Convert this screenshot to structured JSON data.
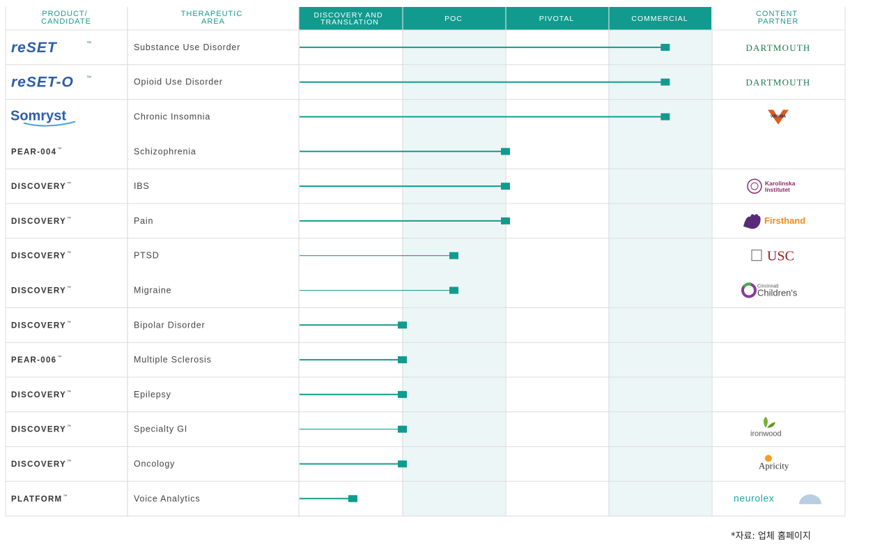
{
  "colors": {
    "accent": "#119b8f",
    "header_band": "#119b8f",
    "shade": "#ecf6f6",
    "grid": "#dcdcdc",
    "text": "#333333",
    "logo_blue": "#2b5da8",
    "dartmouth_green": "#1b7a50",
    "usc_red": "#9d1c20",
    "firsthand_orange": "#f08a1c",
    "karolinska_purple": "#8a2b6a"
  },
  "headers": {
    "product": [
      "PRODUCT/",
      "CANDIDATE"
    ],
    "area": [
      "THERAPEUTIC",
      "AREA"
    ],
    "phases": [
      [
        "DISCOVERY AND",
        "TRANSLATION"
      ],
      [
        "POC"
      ],
      [
        "PIVOTAL"
      ],
      [
        "COMMERCIAL"
      ]
    ],
    "partner": [
      "CONTENT",
      "PARTNER"
    ]
  },
  "rows": [
    {
      "product": "reSET",
      "product_logo": "reset-logo",
      "area": "Substance Use Disorder",
      "stage": 3.55,
      "partner": "DARTMOUTH",
      "partner_logo": "dartmouth-logo"
    },
    {
      "product": "reSET-O",
      "product_logo": "reset-o-logo",
      "area": "Opioid Use Disorder",
      "stage": 3.55,
      "partner": "DARTMOUTH",
      "partner_logo": "dartmouth-logo"
    },
    {
      "product": "Somryst",
      "product_logo": "somryst-logo",
      "area": "Chronic Insomnia",
      "stage": 3.55,
      "partner": "VIRGINIA",
      "partner_logo": "virginia-logo"
    },
    {
      "product": "PEAR-004",
      "product_logo": "",
      "area": "Schizophrenia",
      "stage": 2.0,
      "partner": "",
      "partner_logo": ""
    },
    {
      "product": "DISCOVERY",
      "product_logo": "",
      "area": "IBS",
      "stage": 2.0,
      "partner": "Karolinska Institutet",
      "partner_logo": "karolinska-logo"
    },
    {
      "product": "DISCOVERY",
      "product_logo": "",
      "area": "Pain",
      "stage": 2.0,
      "partner": "Firsthand",
      "partner_logo": "firsthand-logo"
    },
    {
      "product": "DISCOVERY",
      "product_logo": "",
      "area": "PTSD",
      "stage": 1.5,
      "partner": "USC",
      "partner_logo": "usc-logo"
    },
    {
      "product": "DISCOVERY",
      "product_logo": "",
      "area": "Migraine",
      "stage": 1.5,
      "partner": "Cincinnati Children's",
      "partner_logo": "cincinnati-childrens-logo"
    },
    {
      "product": "DISCOVERY",
      "product_logo": "",
      "area": "Bipolar Disorder",
      "stage": 1.0,
      "partner": "",
      "partner_logo": ""
    },
    {
      "product": "PEAR-006",
      "product_logo": "",
      "area": "Multiple Sclerosis",
      "stage": 1.0,
      "partner": "",
      "partner_logo": ""
    },
    {
      "product": "DISCOVERY",
      "product_logo": "",
      "area": "Epilepsy",
      "stage": 1.0,
      "partner": "",
      "partner_logo": ""
    },
    {
      "product": "DISCOVERY",
      "product_logo": "",
      "area": "Specialty GI",
      "stage": 1.0,
      "partner": "Ironwood",
      "partner_logo": "ironwood-logo"
    },
    {
      "product": "DISCOVERY",
      "product_logo": "",
      "area": "Oncology",
      "stage": 1.0,
      "partner": "Apricity",
      "partner_logo": "apricity-logo"
    },
    {
      "product": "PLATFORM",
      "product_logo": "",
      "area": "Voice Analytics",
      "stage": 0.52,
      "partner": "NeuroLex",
      "partner_logo": "neurolex-logo"
    }
  ],
  "source_note": "*자료: 업체 홈페이지"
}
